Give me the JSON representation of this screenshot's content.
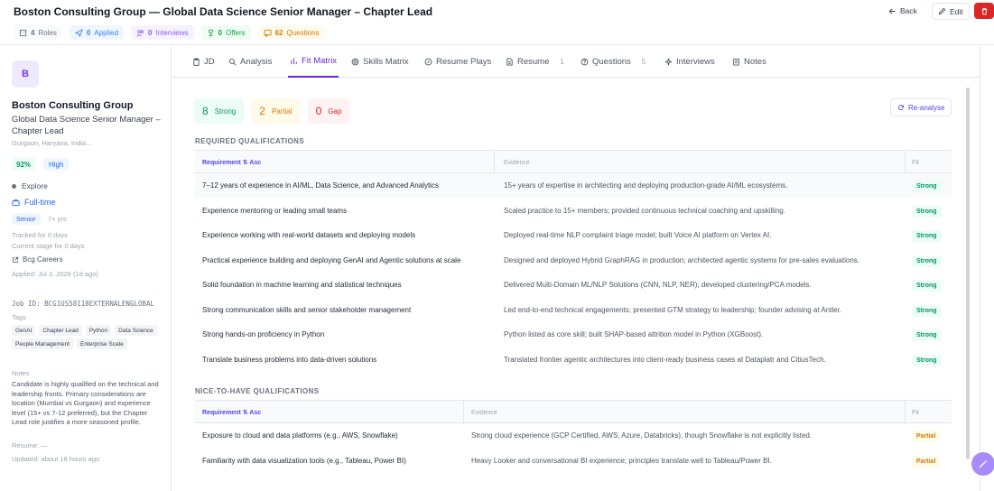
{
  "header": {
    "title": "Boston Consulting Group — Global Data Science Senior Manager – Chapter Lead",
    "stats": {
      "roles": {
        "count": "4",
        "label": "Roles"
      },
      "applied": {
        "count": "0",
        "label": "Applied"
      },
      "interviews": {
        "count": "0",
        "label": "Interviews"
      },
      "offers": {
        "count": "0",
        "label": "Offers"
      },
      "questions": {
        "count": "62",
        "label": "Questions"
      }
    },
    "back_label": "Back",
    "edit_label": "Edit"
  },
  "sidebar": {
    "avatar_letter": "B",
    "company": "Boston Consulting Group",
    "role": "Global Data Science Senior Manager – Chapter Lead",
    "location": "Gurgaon, Haryana, India...",
    "score": "92%",
    "level": "High",
    "stage": "Explore",
    "job_type": "Full-time",
    "seniority": "Senior",
    "years": "7+ yrs",
    "tracked": "Tracked for 0 days",
    "current_stage": "Current stage for 0 days",
    "source": "Bcg Careers",
    "applied_date": "Applied: Jul 3, 2026 (1d ago)",
    "job_id": "Job ID: BCG1US58118EXTERNALENGLOBAL",
    "tags_label": "Tags",
    "tags": [
      "GenAI",
      "Chapter Lead",
      "Python",
      "Data Science",
      "People Management",
      "Enterprise Scale"
    ],
    "notes_label": "Notes",
    "notes": "Candidate is highly qualified on the technical and leadership fronts. Primary considerations are location (Mumbai vs Gurgaon) and experience level (15+ vs 7-12 preferred), but the Chapter Lead role justifies a more seasoned profile.",
    "resume": "Resume: —",
    "updated": "Updated: about 18 hours ago"
  },
  "tabs": [
    {
      "label": "JD",
      "icon": "clipboard-icon",
      "count": ""
    },
    {
      "label": "Analysis",
      "icon": "search-icon",
      "count": ""
    },
    {
      "label": "Fit Matrix",
      "icon": "bar-chart-icon",
      "count": "",
      "active": true
    },
    {
      "label": "Skills Matrix",
      "icon": "target-icon",
      "count": ""
    },
    {
      "label": "Resume Plays",
      "icon": "compass-icon",
      "count": ""
    },
    {
      "label": "Resume",
      "icon": "document-icon",
      "count": "1"
    },
    {
      "label": "Questions",
      "icon": "help-circle-icon",
      "count": "5"
    },
    {
      "label": "Interviews",
      "icon": "sparkle-icon",
      "count": ""
    },
    {
      "label": "Notes",
      "icon": "notes-icon",
      "count": ""
    }
  ],
  "fit_matrix": {
    "summary": {
      "strong": {
        "count": "8",
        "label": "Strong"
      },
      "partial": {
        "count": "2",
        "label": "Partial"
      },
      "gap": {
        "count": "0",
        "label": "Gap"
      }
    },
    "reanalyse_label": "Re-analyse",
    "required": {
      "title": "REQUIRED QUALIFICATIONS",
      "headers": {
        "requirement": "Requirement ⇅ Asc",
        "evidence": "Evidence",
        "fit": "Fit"
      },
      "rows": [
        {
          "requirement": "7–12 years of experience in AI/ML, Data Science, and Advanced Analytics",
          "evidence": "15+ years of expertise in architecting and deploying production-grade AI/ML ecosystems.",
          "fit": "Strong"
        },
        {
          "requirement": "Experience mentoring or leading small teams",
          "evidence": "Scaled practice to 15+ members; provided continuous technical coaching and upskilling.",
          "fit": "Strong"
        },
        {
          "requirement": "Experience working with real-world datasets and deploying models",
          "evidence": "Deployed real-time NLP complaint triage model; built Voice AI platform on Vertex AI.",
          "fit": "Strong"
        },
        {
          "requirement": "Practical experience building and deploying GenAI and Agentic solutions at scale",
          "evidence": "Designed and deployed Hybrid GraphRAG in production; architected agentic systems for pre-sales evaluations.",
          "fit": "Strong"
        },
        {
          "requirement": "Solid foundation in machine learning and statistical techniques",
          "evidence": "Delivered Multi-Domain ML/NLP Solutions (CNN, NLP, NER); developed clustering/PCA models.",
          "fit": "Strong"
        },
        {
          "requirement": "Strong communication skills and senior stakeholder management",
          "evidence": "Led end-to-end technical engagements; presented GTM strategy to leadership; founder advising at Antler.",
          "fit": "Strong"
        },
        {
          "requirement": "Strong hands-on proficiency in Python",
          "evidence": "Python listed as core skill; built SHAP-based attrition model in Python (XGBoost).",
          "fit": "Strong"
        },
        {
          "requirement": "Translate business problems into data-driven solutions",
          "evidence": "Translated frontier agentic architectures into client-ready business cases at Dataplatr and CitiusTech.",
          "fit": "Strong"
        }
      ]
    },
    "nice_to_have": {
      "title": "NICE-TO-HAVE QUALIFICATIONS",
      "headers": {
        "requirement": "Requirement ⇅ Asc",
        "evidence": "Evidence",
        "fit": "Fit"
      },
      "rows": [
        {
          "requirement": "Exposure to cloud and data platforms (e.g., AWS, Snowflake)",
          "evidence": "Strong cloud experience (GCP Certified, AWS, Azure, Databricks), though Snowflake is not explicitly listed.",
          "fit": "Partial"
        },
        {
          "requirement": "Familiarity with data visualization tools (e.g., Tableau, Power BI)",
          "evidence": "Heavy Looker and conversational BI experience; principles translate well to Tableau/Power BI.",
          "fit": "Partial"
        }
      ]
    }
  },
  "colors": {
    "accent": "#6d28d9",
    "strong": "#059669",
    "partial": "#d97706",
    "gap": "#dc2626",
    "delete": "#dc2626"
  }
}
